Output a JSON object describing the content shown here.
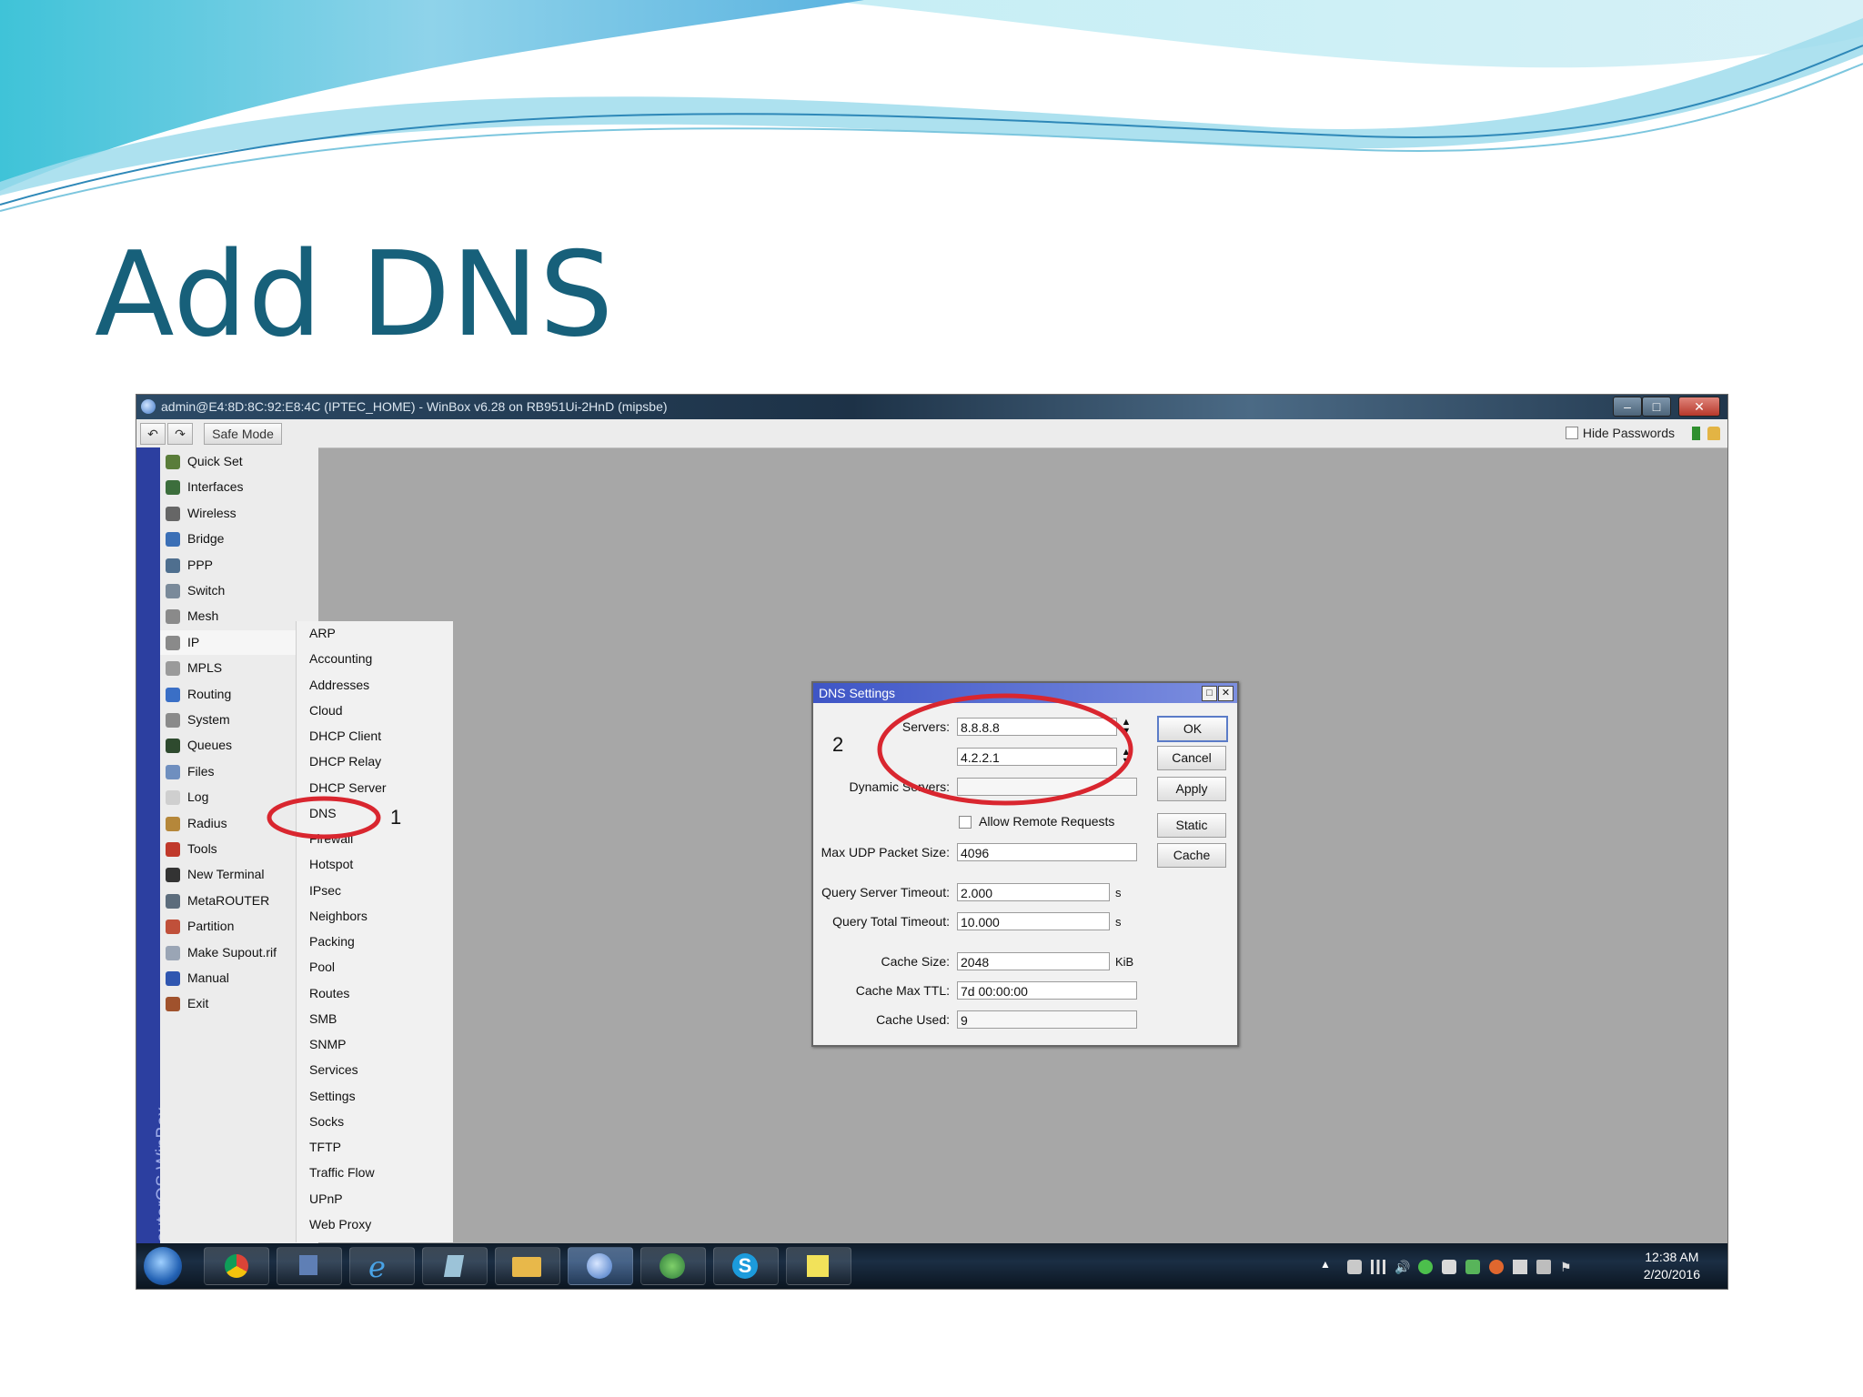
{
  "slide": {
    "title": "Add DNS"
  },
  "window": {
    "title": "admin@E4:8D:8C:92:E8:4C (IPTEC_HOME) - WinBox v6.28 on RB951Ui-2HnD (mipsbe)"
  },
  "toolbar": {
    "safe_mode": "Safe Mode",
    "hide_passwords": "Hide Passwords"
  },
  "side_label": "RouterOS WinBox",
  "main_menu": [
    {
      "label": "Quick Set",
      "icon": "quickset-icon",
      "color": "#5a7d3a"
    },
    {
      "label": "Interfaces",
      "icon": "interfaces-icon",
      "color": "#3c6e3c"
    },
    {
      "label": "Wireless",
      "icon": "wireless-icon",
      "color": "#666666"
    },
    {
      "label": "Bridge",
      "icon": "bridge-icon",
      "color": "#3b6fb6"
    },
    {
      "label": "PPP",
      "icon": "ppp-icon",
      "color": "#4f6f8f"
    },
    {
      "label": "Switch",
      "icon": "switch-icon",
      "color": "#7a8a9a"
    },
    {
      "label": "Mesh",
      "icon": "mesh-icon",
      "color": "#8a8a8a"
    },
    {
      "label": "IP",
      "icon": "ip-icon",
      "color": "#8a8a8a",
      "submenu": true
    },
    {
      "label": "MPLS",
      "icon": "mpls-icon",
      "color": "#9a9a9a",
      "submenu": true
    },
    {
      "label": "Routing",
      "icon": "routing-icon",
      "color": "#3a6fc6",
      "submenu": true
    },
    {
      "label": "System",
      "icon": "system-icon",
      "color": "#8a8a8a",
      "submenu": true
    },
    {
      "label": "Queues",
      "icon": "queues-icon",
      "color": "#2e4a2e"
    },
    {
      "label": "Files",
      "icon": "files-icon",
      "color": "#6f8fbf"
    },
    {
      "label": "Log",
      "icon": "log-icon",
      "color": "#cfcfcf"
    },
    {
      "label": "Radius",
      "icon": "radius-icon",
      "color": "#b5873a"
    },
    {
      "label": "Tools",
      "icon": "tools-icon",
      "color": "#c0392b",
      "submenu": true
    },
    {
      "label": "New Terminal",
      "icon": "terminal-icon",
      "color": "#333333"
    },
    {
      "label": "MetaROUTER",
      "icon": "metarouter-icon",
      "color": "#5c6c7c"
    },
    {
      "label": "Partition",
      "icon": "partition-icon",
      "color": "#c0503a"
    },
    {
      "label": "Make Supout.rif",
      "icon": "supout-icon",
      "color": "#9aa5b5"
    },
    {
      "label": "Manual",
      "icon": "manual-icon",
      "color": "#2f56b0"
    },
    {
      "label": "Exit",
      "icon": "exit-icon",
      "color": "#a0522d"
    }
  ],
  "ip_submenu": [
    "ARP",
    "Accounting",
    "Addresses",
    "Cloud",
    "DHCP Client",
    "DHCP Relay",
    "DHCP Server",
    "DNS",
    "Firewall",
    "Hotspot",
    "IPsec",
    "Neighbors",
    "Packing",
    "Pool",
    "Routes",
    "SMB",
    "SNMP",
    "Services",
    "Settings",
    "Socks",
    "TFTP",
    "Traffic Flow",
    "UPnP",
    "Web Proxy"
  ],
  "annotations": {
    "step1": "1",
    "step2": "2"
  },
  "dns_dialog": {
    "title": "DNS Settings",
    "servers_label": "Servers:",
    "servers": [
      "8.8.8.8",
      "4.2.2.1"
    ],
    "dynamic_servers_label": "Dynamic Servers:",
    "dynamic_servers": "",
    "allow_remote_label": "Allow Remote Requests",
    "max_udp_label": "Max UDP Packet Size:",
    "max_udp": "4096",
    "query_server_timeout_label": "Query Server Timeout:",
    "query_server_timeout": "2.000",
    "query_total_timeout_label": "Query Total Timeout:",
    "query_total_timeout": "10.000",
    "seconds_unit": "s",
    "cache_size_label": "Cache Size:",
    "cache_size": "2048",
    "kib_unit": "KiB",
    "cache_max_ttl_label": "Cache Max TTL:",
    "cache_max_ttl": "7d 00:00:00",
    "cache_used_label": "Cache Used:",
    "cache_used": "9",
    "buttons": {
      "ok": "OK",
      "cancel": "Cancel",
      "apply": "Apply",
      "static": "Static",
      "cache": "Cache"
    }
  },
  "taskbar": {
    "time": "12:38 AM",
    "date": "2/20/2016"
  },
  "colors": {
    "title": "#17607a",
    "annotation_circle": "#d9262f",
    "dialog_title": "#3e55c6"
  }
}
